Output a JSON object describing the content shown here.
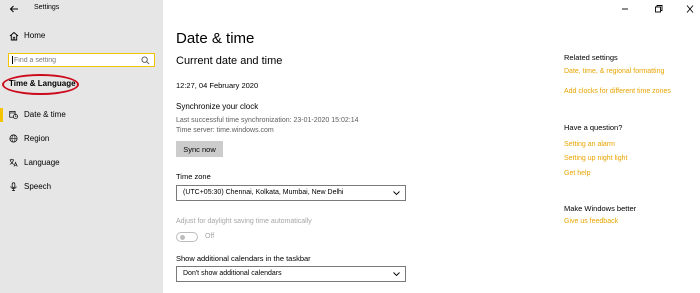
{
  "app": {
    "title": "Settings"
  },
  "sidebar": {
    "home_label": "Home",
    "search_placeholder": "Find a setting",
    "section_heading": "Time & Language",
    "items": [
      {
        "label": "Date & time",
        "icon": "calendar-clock-icon",
        "active": true
      },
      {
        "label": "Region",
        "icon": "globe-icon",
        "active": false
      },
      {
        "label": "Language",
        "icon": "language-icon",
        "active": false
      },
      {
        "label": "Speech",
        "icon": "microphone-icon",
        "active": false
      }
    ]
  },
  "main": {
    "title": "Date & time",
    "current_section": "Current date and time",
    "current_datetime": "12:27, 04 February 2020",
    "sync": {
      "title": "Synchronize your clock",
      "last_sync": "Last successful time synchronization: 23-01-2020 15:02:14",
      "server": "Time server: time.windows.com",
      "button": "Sync now"
    },
    "timezone": {
      "label": "Time zone",
      "value": "(UTC+05:30) Chennai, Kolkata, Mumbai, New Delhi"
    },
    "dst": {
      "label": "Adjust for daylight saving time automatically",
      "state": "Off"
    },
    "calendars": {
      "label": "Show additional calendars in the taskbar",
      "value": "Don't show additional calendars"
    }
  },
  "right": {
    "related_heading": "Related settings",
    "related_links": [
      "Date, time, & regional formatting",
      "Add clocks for different time zones"
    ],
    "question_heading": "Have a question?",
    "question_links": [
      "Setting an alarm",
      "Setting up night light",
      "Get help"
    ],
    "better_heading": "Make Windows better",
    "better_links": [
      "Give us feedback"
    ]
  },
  "colors": {
    "accent": "#f5c400",
    "link": "#e8a400",
    "annotation": "#cc0a1c",
    "sidebar_bg": "#e6e6e6"
  }
}
